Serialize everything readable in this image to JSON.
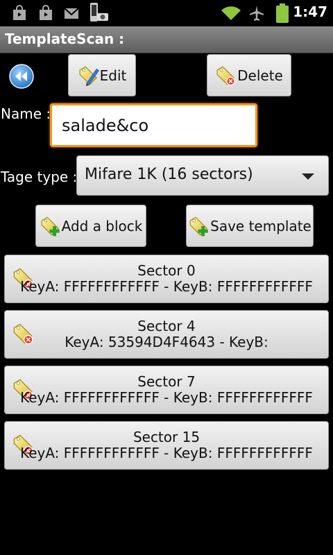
{
  "status_bar": {
    "time": "1:47",
    "icons": [
      "shopping-bag-icon",
      "shopping-bag-icon",
      "gmail-icon",
      "phone-camera-icon",
      "wifi-icon",
      "airplane-icon",
      "battery-icon"
    ]
  },
  "app": {
    "title": "TemplateScan :"
  },
  "toolbar": {
    "edit_label": "Edit",
    "delete_label": "Delete"
  },
  "form": {
    "name_label": "Name :",
    "name_value": "salade&co",
    "tag_type_label": "Tage type :",
    "tag_type_value": "Mifare 1K (16 sectors)"
  },
  "actions": {
    "add_block_label": "Add a block",
    "save_template_label": "Save template"
  },
  "sectors": [
    {
      "title": "Sector 0",
      "keys": "KeyA: FFFFFFFFFFFF - KeyB: FFFFFFFFFFFF"
    },
    {
      "title": "Sector 4",
      "keys": "KeyA: 53594D4F4643 - KeyB:"
    },
    {
      "title": "Sector 7",
      "keys": "KeyA: FFFFFFFFFFFF - KeyB: FFFFFFFFFFFF"
    },
    {
      "title": "Sector 15",
      "keys": "KeyA: FFFFFFFFFFFF - KeyB: FFFFFFFFFFFF"
    }
  ],
  "colors": {
    "focus_border": "#f7941d",
    "back_button": "#3a8ee6",
    "battery": "#8dc63f",
    "wifi": "#8dc63f"
  }
}
